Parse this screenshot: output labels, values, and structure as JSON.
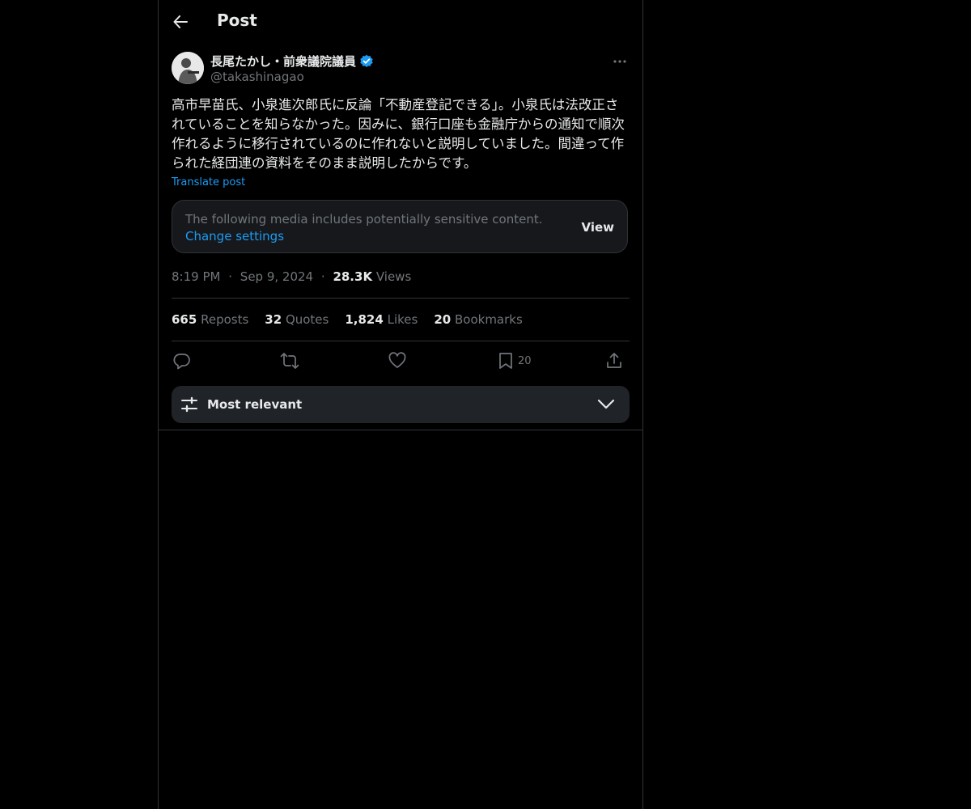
{
  "header": {
    "title": "Post"
  },
  "author": {
    "display_name": "長尾たかし・前衆議院議員",
    "handle": "@takashinagao",
    "verified_badge_color": "#1d9bf0"
  },
  "post": {
    "text": "高市早苗氏、小泉進次郎氏に反論「不動産登記できる」。小泉氏は法改正されていることを知らなかった。因みに、銀行口座も金融庁からの通知で順次作れるように移行されているのに作れないと説明していました。間違って作られた経団連の資料をそのまま説明したからです。",
    "translate_label": "Translate post",
    "sensitive_notice": "The following media includes potentially sensitive content.",
    "change_settings_label": "Change settings",
    "view_label": "View",
    "time": "8:19 PM",
    "date": "Sep 9, 2024",
    "separator": "·",
    "views_count": "28.3K",
    "views_label": "Views"
  },
  "stats": {
    "reposts_count": "665",
    "reposts_label": "Reposts",
    "quotes_count": "32",
    "quotes_label": "Quotes",
    "likes_count": "1,824",
    "likes_label": "Likes",
    "bookmarks_count": "20",
    "bookmarks_label": "Bookmarks"
  },
  "actions": {
    "bookmark_count": "20"
  },
  "sort": {
    "label": "Most relevant"
  },
  "colors": {
    "accent": "#1d9bf0",
    "background": "#000000",
    "muted": "#71767b",
    "border": "#2f3336"
  }
}
